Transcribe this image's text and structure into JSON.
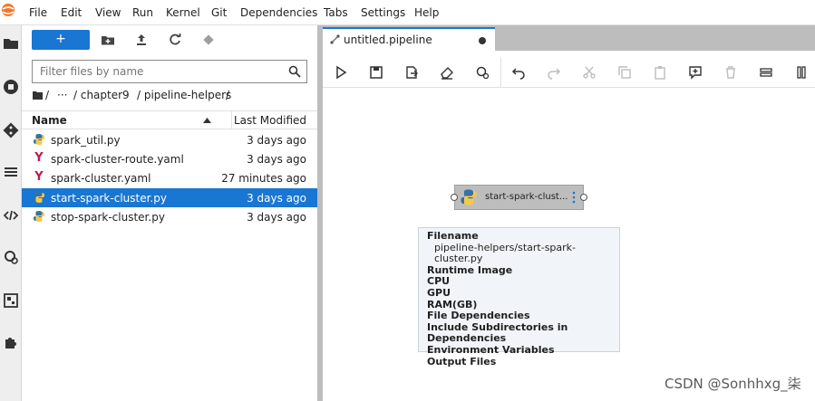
{
  "menubar": {
    "items": [
      "File",
      "Edit",
      "View",
      "Run",
      "Kernel",
      "Git",
      "Dependencies",
      "Tabs",
      "Settings",
      "Help"
    ]
  },
  "activity_bar": {
    "icons": [
      "folder-icon",
      "stop-circle-icon",
      "git-icon",
      "list-icon",
      "code-icon",
      "gear-cluster-icon",
      "image-table-icon",
      "puzzle-icon"
    ]
  },
  "file_browser": {
    "new_button_label": "+",
    "filter_placeholder": "Filter files by name",
    "breadcrumb": [
      "/",
      "···",
      "/ chapter9",
      "/ pipeline-helpers",
      "/"
    ],
    "columns": {
      "name": "Name",
      "last_modified": "Last Modified"
    },
    "files": [
      {
        "name": "spark_util.py",
        "modified": "3 days ago",
        "icon": "python-icon",
        "selected": false
      },
      {
        "name": "spark-cluster-route.yaml",
        "modified": "3 days ago",
        "icon": "yaml-icon",
        "selected": false
      },
      {
        "name": "spark-cluster.yaml",
        "modified": "27 minutes ago",
        "icon": "yaml-icon",
        "selected": false
      },
      {
        "name": "start-spark-cluster.py",
        "modified": "3 days ago",
        "icon": "python-icon",
        "selected": true
      },
      {
        "name": "stop-spark-cluster.py",
        "modified": "3 days ago",
        "icon": "python-icon",
        "selected": false
      }
    ]
  },
  "editor": {
    "tab_title": "untitled.pipeline",
    "node_label": "start-spark-clust...",
    "tooltip": {
      "filename_label": "Filename",
      "filename_value": "pipeline-helpers/start-spark-cluster.py",
      "runtime_image": "Runtime Image",
      "cpu": "CPU",
      "gpu": "GPU",
      "ram": "RAM(GB)",
      "file_dependencies": "File Dependencies",
      "include_subdirs": "Include Subdirectories in Dependencies",
      "env_vars": "Environment Variables",
      "output_files": "Output Files"
    }
  },
  "watermark": "CSDN @Sonhhxg_柒",
  "colors": {
    "accent": "#1976d2",
    "selected_row": "#1976d2",
    "tooltip_bg": "#f1f5f9"
  }
}
